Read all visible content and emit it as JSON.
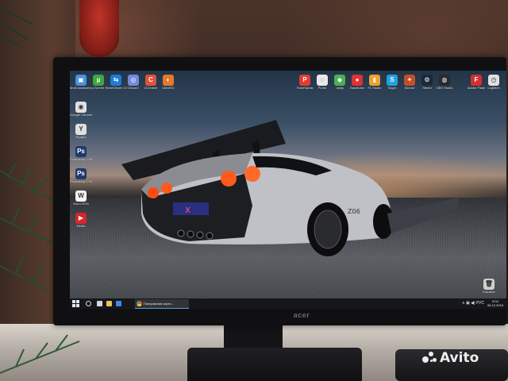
{
  "desktop": {
    "icons_left": [
      {
        "label": "Мой компьютер",
        "color": "#4a90d9",
        "glyph": "▣"
      },
      {
        "label": "Google Chrome",
        "color": "#e0e0e0",
        "glyph": "◉"
      },
      {
        "label": "Яндекс",
        "color": "#e0e0e0",
        "glyph": "Y"
      },
      {
        "label": "Photoshop CS6",
        "color": "#1e3a6e",
        "glyph": "Ps"
      },
      {
        "label": "Photoshop CS6 x64",
        "color": "#1e3a6e",
        "glyph": "Ps"
      },
      {
        "label": "Word 2016",
        "color": "#f2f2f2",
        "glyph": "W"
      },
      {
        "label": "Media",
        "color": "#d8262b",
        "glyph": "▶"
      }
    ],
    "icons_top_left": [
      {
        "label": "uTorrent",
        "color": "#3da83d",
        "glyph": "µ"
      },
      {
        "label": "TeamViewer 13",
        "color": "#1e7bd6",
        "glyph": "⇆"
      },
      {
        "label": "Discord",
        "color": "#7289da",
        "glyph": "◎"
      },
      {
        "label": "CCleaner",
        "color": "#e0523a",
        "glyph": "C"
      },
      {
        "label": "UltraISO",
        "color": "#e2792c",
        "glyph": "◐"
      }
    ],
    "icons_top_right": [
      {
        "label": "TeamSpeak",
        "color": "#e53b2f",
        "glyph": "P"
      },
      {
        "label": "Punto",
        "color": "#e8e8e8",
        "glyph": "◌"
      },
      {
        "label": "Uplay",
        "color": "#4caf50",
        "glyph": "◆"
      },
      {
        "label": "Bandicam",
        "color": "#e03030",
        "glyph": "●"
      },
      {
        "label": "FL Studio",
        "color": "#f0a030",
        "glyph": "▮"
      },
      {
        "label": "Skype",
        "color": "#1ea2e0",
        "glyph": "S"
      },
      {
        "label": "Movavi",
        "color": "#c0502a",
        "glyph": "✦"
      },
      {
        "label": "Steam",
        "color": "#1b2838",
        "glyph": "⚙"
      },
      {
        "label": "OBS Studio",
        "color": "#2a2a2a",
        "glyph": "◍"
      },
      {
        "label": "Adobe Flash",
        "color": "#d32f2f",
        "glyph": "F"
      },
      {
        "label": "Logitech",
        "color": "#e0e0e0",
        "glyph": "◷"
      }
    ],
    "icons_right": [
      {
        "label": "Корзина",
        "color": "#cfcfcf",
        "glyph": "🗑"
      }
    ]
  },
  "taskbar": {
    "chrome_task_label": "Панорамная карта...",
    "tray_text": "∧ ▣ ◀) РУС",
    "time": "9:04",
    "date": "06.12.2018"
  },
  "monitor": {
    "brand": "acer"
  },
  "watermark": {
    "text": "Avito"
  },
  "colors": {
    "taillight": "#ff5a1a",
    "car_body": "#c9cbcf",
    "taskbar_bg": "#121418"
  }
}
